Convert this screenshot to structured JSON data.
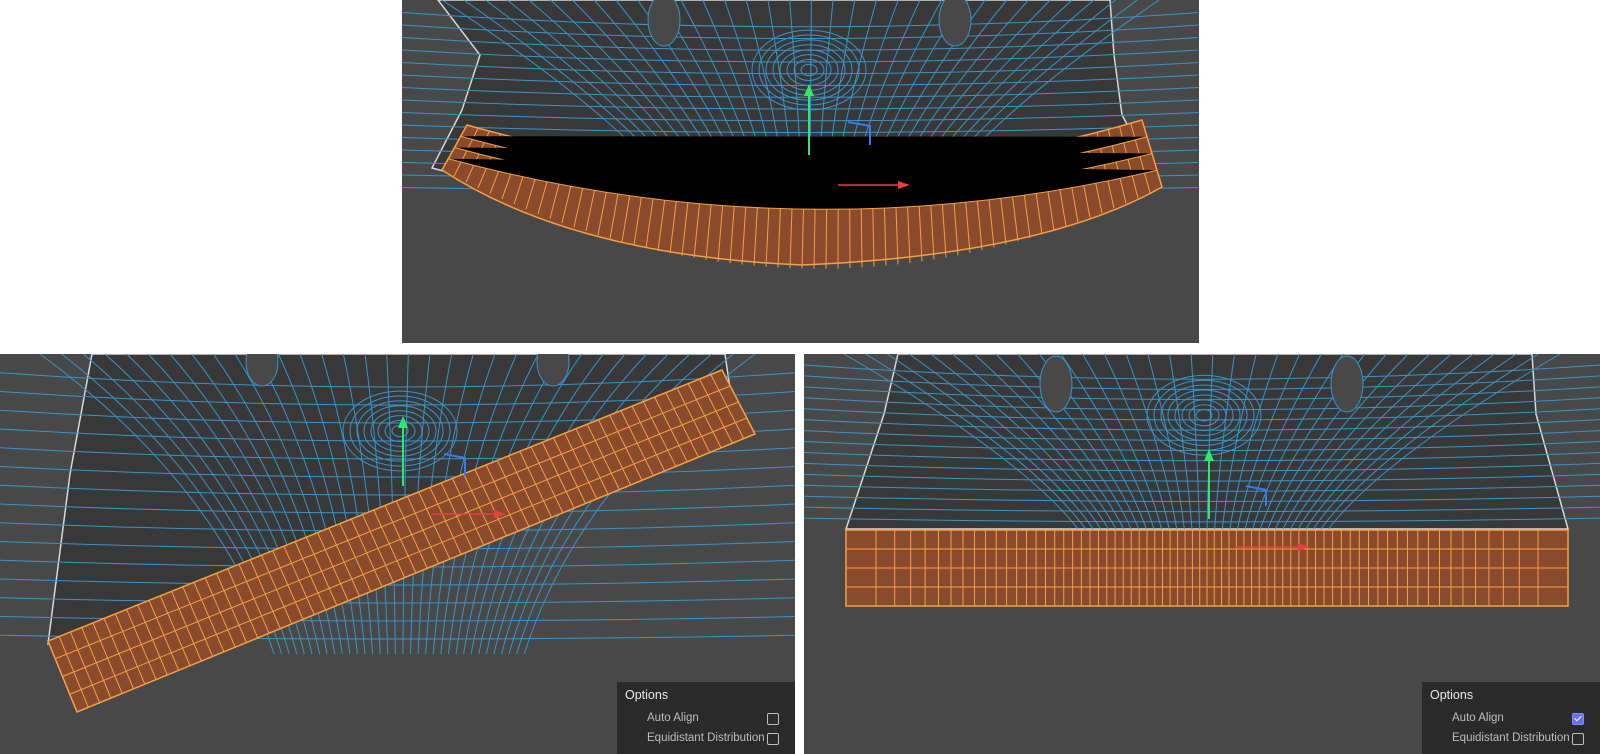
{
  "colors": {
    "viewport_bg": "#484848",
    "mesh_bg": "#383838",
    "uv_wire": "#3a94c8",
    "selected_fill": "#8a4a2c",
    "selected_wire": "#f4a045",
    "outline": "#d8d8d8",
    "axis_y": "#2ee870",
    "axis_x": "#e84040",
    "axis_z": "#3a7ae8",
    "panel_bg": "#2a2a2a",
    "checkbox_checked": "#6c6cf5"
  },
  "views": [
    {
      "id": "before",
      "selection_state": "curved"
    },
    {
      "id": "straightened-no-align",
      "selection_state": "rotated"
    },
    {
      "id": "straightened-auto-align",
      "selection_state": "horizontal"
    }
  ],
  "panels": {
    "left": {
      "title": "Options",
      "options": [
        {
          "label": "Auto Align",
          "checked": false
        },
        {
          "label": "Equidistant Distribution",
          "checked": false
        }
      ]
    },
    "right": {
      "title": "Options",
      "options": [
        {
          "label": "Auto Align",
          "checked": true
        },
        {
          "label": "Equidistant Distribution",
          "checked": false
        }
      ]
    }
  }
}
